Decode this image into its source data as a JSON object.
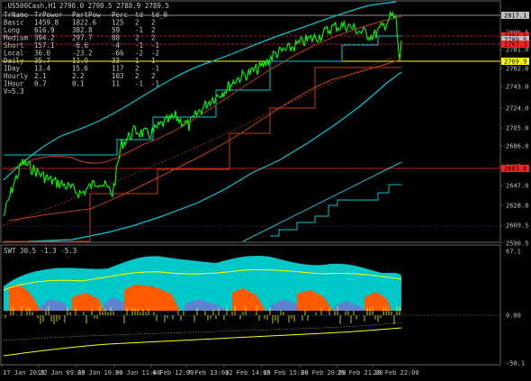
{
  "header": {
    "symbol": ".US500Cash,H1",
    "ohlc": "2790.0 2790.5 2788.9 2789.5"
  },
  "stats_table": {
    "headers": [
      "TrName",
      "TrPower",
      "PartPow",
      "Perc",
      "td",
      "td_0"
    ],
    "rows": [
      [
        "Basic",
        "1459.8",
        "1822.6",
        "125",
        "2",
        "2"
      ],
      [
        "Long",
        "616.9",
        "382.8",
        "59",
        "-1",
        "2"
      ],
      [
        "Medium",
        "394.2",
        "297.7",
        "88",
        "2",
        "2"
      ],
      [
        "Short",
        "157.1",
        "-6.6",
        "-4",
        "-1",
        "-1"
      ],
      [
        "Local",
        "36.0",
        "-23.2",
        "-66",
        "-2",
        "-2"
      ],
      [
        "Daily",
        "35.7",
        "11.9",
        "33",
        "1",
        "1"
      ],
      [
        "IDay",
        "13.4",
        "15.6",
        "117",
        "2",
        "-1"
      ],
      [
        "Hourly",
        "2.1",
        "2.2",
        "103",
        "2",
        "2"
      ],
      [
        "IHour",
        "0.7",
        "0.1",
        "11",
        "-1",
        "-1"
      ]
    ],
    "volatility": "V=5.3"
  },
  "price_axis": {
    "ticks": [
      "2800.5",
      "2781.0",
      "2762.0",
      "2743.0",
      "2724.0",
      "2705.0",
      "2686.0",
      "2667.0",
      "2647.0",
      "2628.0",
      "2609.5",
      "2590.5"
    ],
    "tags": [
      {
        "text": "2817.1",
        "color": "#c0c0c0"
      },
      {
        "text": "2794.0",
        "color": "#ff2020"
      },
      {
        "text": "2789.5",
        "color": "#c0c0c0"
      },
      {
        "text": "2787.3",
        "color": "#ff2020"
      },
      {
        "text": "2769.9",
        "color": "#ffff00"
      },
      {
        "text": "2663.6",
        "color": "#ff2020"
      }
    ]
  },
  "indicator": {
    "label": "SWT 30.5 -1.3 -5.3",
    "ticks": [
      "67.1",
      "0.00",
      "-50.1"
    ]
  },
  "time_axis": {
    "labels": [
      "17 Jan 2019",
      "22 Jan 09:00",
      "25 Jan 10:00",
      "30 Jan 11:00",
      "4 Feb 12:00",
      "7 Feb 13:00",
      "12 Feb 14:00",
      "15 Feb 15:00",
      "20 Feb 20:00",
      "25 Feb 21:00",
      "28 Feb 22:00"
    ]
  },
  "colors": {
    "background": "#000000",
    "price": "#00ff00",
    "channel": "#00c8d8",
    "trend": "#c04010",
    "support": "#ffff00",
    "orange": "#ff5a00",
    "cyan_fill": "#00c8c8",
    "blue": "#6080d0"
  }
}
